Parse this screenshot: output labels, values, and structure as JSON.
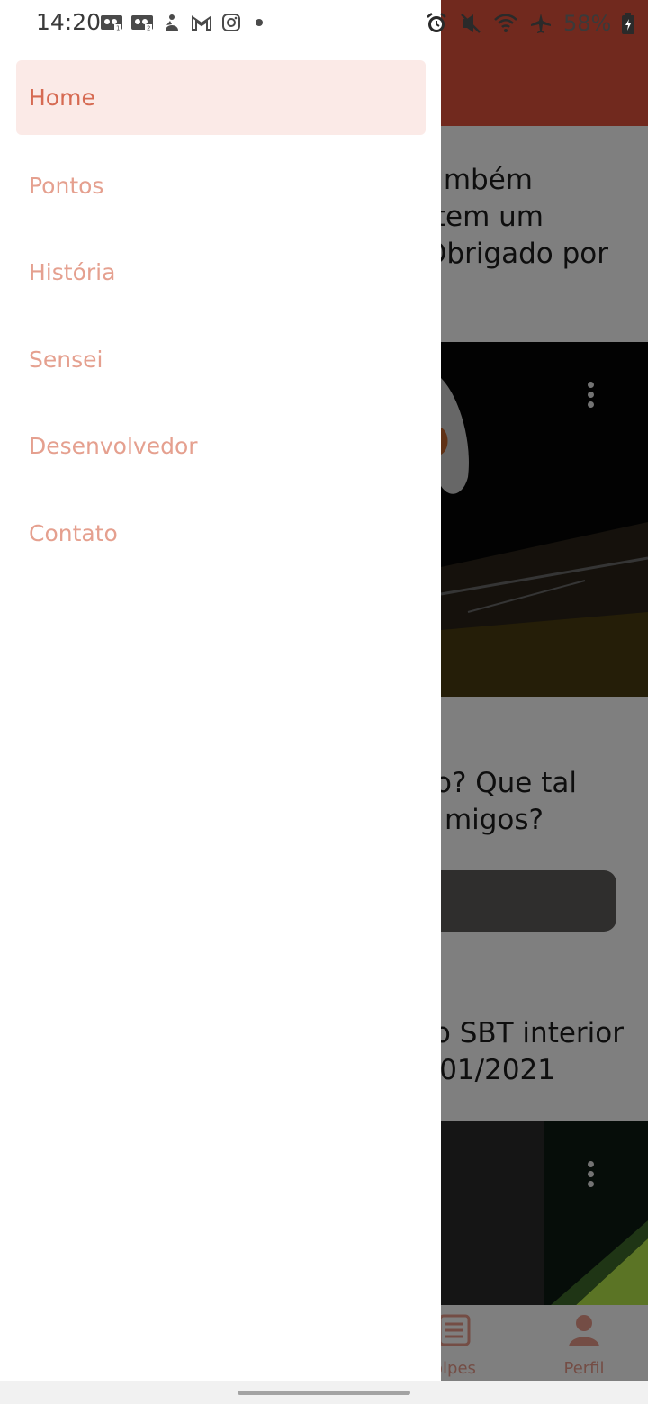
{
  "status_bar": {
    "time": "14:20",
    "battery": "58%",
    "left_icons": [
      "voicemail-icon",
      "voicemail-icon",
      "app-icon",
      "gmail-icon",
      "instagram-icon",
      "dot-icon"
    ],
    "right_icons": [
      "alarm-icon",
      "vibrate-off-icon",
      "wifi-icon",
      "airplane-icon",
      "battery-icon"
    ]
  },
  "drawer": {
    "items": [
      {
        "label": "Home",
        "active": true
      },
      {
        "label": "Pontos",
        "active": false
      },
      {
        "label": "História",
        "active": false
      },
      {
        "label": "Sensei",
        "active": false
      },
      {
        "label": "Desenvolvedor",
        "active": false
      },
      {
        "label": "Contato",
        "active": false
      }
    ]
  },
  "background": {
    "block1_lines": [
      "mbém",
      "tem um",
      "Obrigado por"
    ],
    "block2_lines": [
      "o? Que tal",
      "migos?"
    ],
    "block3_lines": [
      "o SBT interior",
      "01/2021"
    ],
    "bottom_nav": [
      {
        "label": "olpes",
        "icon": "list-icon"
      },
      {
        "label": "Perfil",
        "icon": "person-icon"
      }
    ]
  },
  "colors": {
    "accent": "#e2523c",
    "drawer_active_bg": "#fbeae7",
    "drawer_active_text": "#d66a52",
    "drawer_text": "#e5a08f"
  }
}
